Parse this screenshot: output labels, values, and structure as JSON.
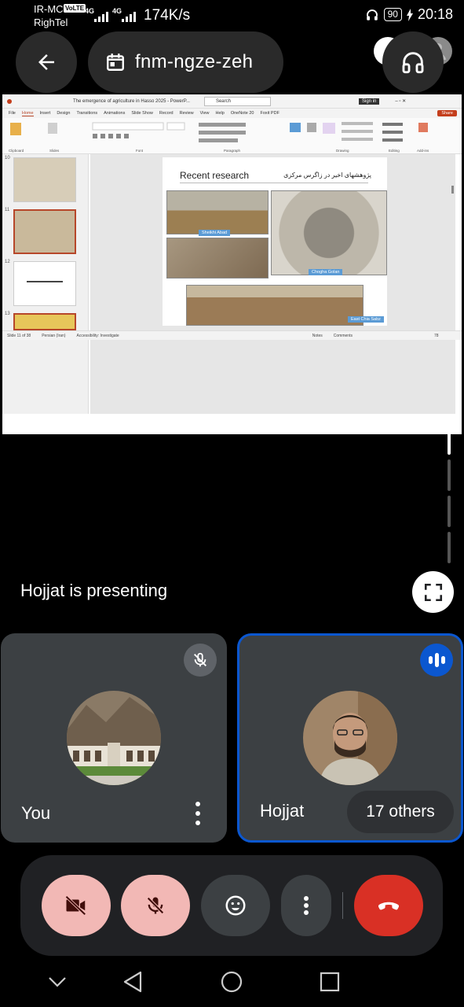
{
  "status_bar": {
    "carrier_primary": "IR-MCI",
    "volte": "VoLTE",
    "carrier_secondary": "RighTel",
    "network1": "4G",
    "network2": "4G",
    "speed": "174K/s",
    "battery": "90",
    "time": "20:18"
  },
  "header": {
    "meeting_code": "fnm-ngze-zeh"
  },
  "presentation": {
    "presenting_label": "Hojjat is presenting",
    "window_title": "The emergence of agriculture in Hasso 2025 - PowerP...",
    "search_placeholder": "Search",
    "sign_in": "Sign in",
    "share": "Share",
    "menu": [
      "File",
      "Home",
      "Insert",
      "Design",
      "Transitions",
      "Animations",
      "Slide Show",
      "Record",
      "Review",
      "View",
      "Help",
      "OneNote 20",
      "Foxit PDF"
    ],
    "slide_numbers": [
      "10",
      "11",
      "12",
      "13"
    ],
    "slide": {
      "title_en": "Recent research",
      "title_fa": "پژوهشهای اخیر در زاگرس مرکزی",
      "captions": [
        "Sheikhi Abad",
        "Chogha Golan",
        "East Chia Sabz"
      ]
    },
    "status_left": "Slide 11 of 38",
    "status_mid": "Persian (Iran)",
    "status_access": "Accessibility: Investigate",
    "status_notes": "Notes",
    "status_comments": "Comments",
    "zoom": "78"
  },
  "participants": [
    {
      "name": "You",
      "muted": true
    },
    {
      "name": "Hojjat",
      "speaking": true
    }
  ],
  "others_label": "17 others",
  "colors": {
    "accent_blue": "#0b57d0",
    "tile_bg": "#3c4043",
    "muted_control": "#f2b8b5",
    "hangup": "#d93025"
  }
}
